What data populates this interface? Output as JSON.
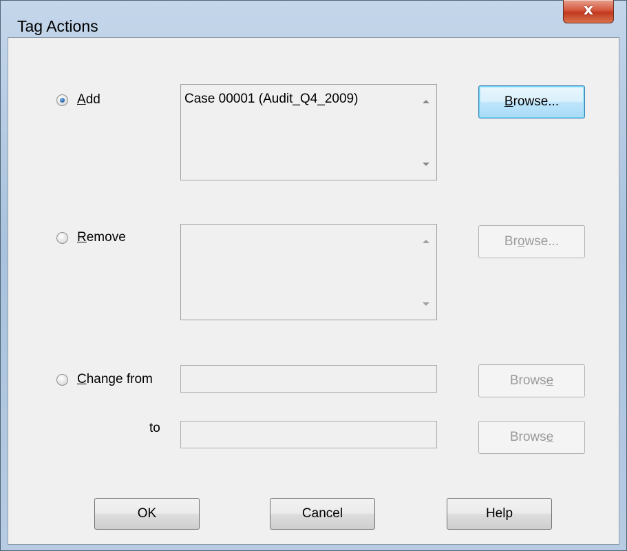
{
  "window": {
    "title": "Tag Actions",
    "close_glyph": "x"
  },
  "add": {
    "label_prefix": "",
    "label_mnemonic": "A",
    "label_rest": "dd",
    "selected": true,
    "list_items": [
      "Case 00001 (Audit_Q4_2009)"
    ],
    "browse": {
      "pre": "",
      "mn": "B",
      "post": "rowse...",
      "enabled": true
    }
  },
  "remove": {
    "label_prefix": "",
    "label_mnemonic": "R",
    "label_rest": "emove",
    "selected": false,
    "list_items": [],
    "browse": {
      "pre": "Br",
      "mn": "o",
      "post": "wse...",
      "enabled": false
    }
  },
  "change": {
    "label_prefix": "",
    "label_mnemonic": "C",
    "label_rest": "hange from",
    "selected": false,
    "from_value": "",
    "to_label": "to",
    "to_value": "",
    "browse_from": {
      "pre": "Brows",
      "mn": "e",
      "post": "",
      "enabled": false
    },
    "browse_to": {
      "pre": "Brows",
      "mn": "e",
      "post": "",
      "enabled": false
    }
  },
  "footer": {
    "ok": "OK",
    "cancel": "Cancel",
    "help": "Help"
  },
  "icons": {
    "close": "close-icon",
    "radio": "radio-icon",
    "scroll_up": "scroll-up-arrow-icon",
    "scroll_down": "scroll-down-arrow-icon"
  },
  "colors": {
    "client_bg": "#f0f0f0",
    "close_red": "#c2391e",
    "default_button_border": "#3c7fb1",
    "disabled_text": "#9a9a9a"
  }
}
